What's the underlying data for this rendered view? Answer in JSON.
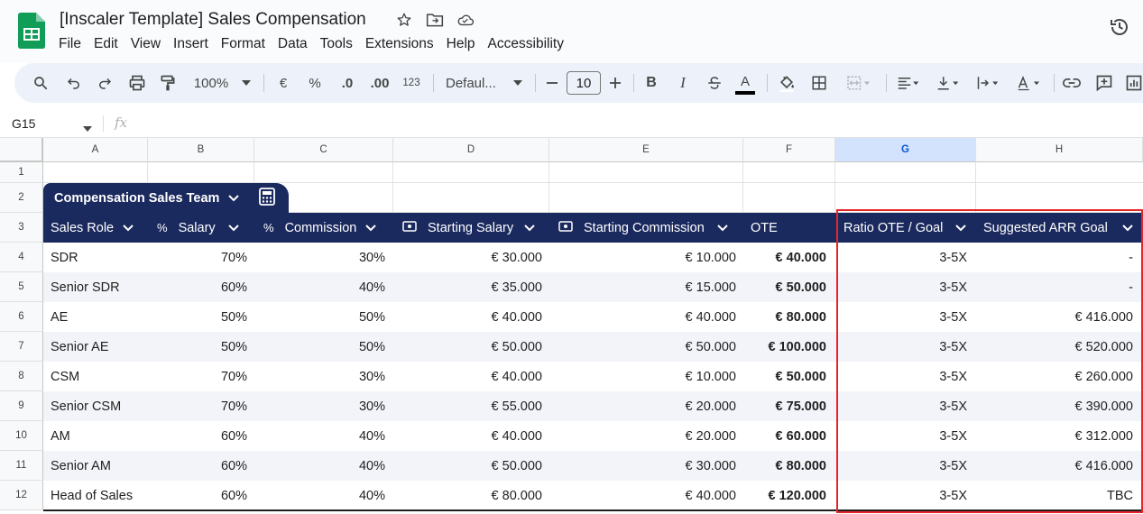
{
  "app": {
    "title": "[Inscaler Template] Sales Compensation",
    "menu": [
      "File",
      "Edit",
      "View",
      "Insert",
      "Format",
      "Data",
      "Tools",
      "Extensions",
      "Help",
      "Accessibility"
    ]
  },
  "toolbar": {
    "zoom": "100%",
    "currency": "€",
    "percent": "%",
    "dec_decrease": ".0",
    "dec_increase": ".00",
    "number_format": "123",
    "font": "Defaul...",
    "font_size": "10",
    "bold": "B",
    "italic": "I",
    "text_color": "A"
  },
  "formula_bar": {
    "name_box": "G15",
    "fx": "fx"
  },
  "columns": [
    "A",
    "B",
    "C",
    "D",
    "E",
    "F",
    "G",
    "H"
  ],
  "selected_column": "G",
  "rows": [
    "1",
    "2",
    "3",
    "4",
    "5",
    "6",
    "7",
    "8",
    "9",
    "10",
    "11",
    "12"
  ],
  "table": {
    "name": "Compensation Sales Team",
    "headers": [
      "Sales Role",
      "Salary",
      "Commission",
      "Starting Salary",
      "Starting Commission",
      "OTE",
      "Ratio OTE / Goal",
      "Suggested ARR Goal"
    ],
    "header_icons": [
      "",
      "%",
      "%",
      "₪",
      "₪",
      "",
      "",
      ""
    ],
    "records": [
      [
        "SDR",
        "70%",
        "30%",
        "€ 30.000",
        "€ 10.000",
        "€ 40.000",
        "3-5X",
        "-"
      ],
      [
        "Senior SDR",
        "60%",
        "40%",
        "€ 35.000",
        "€ 15.000",
        "€ 50.000",
        "3-5X",
        "-"
      ],
      [
        "AE",
        "50%",
        "50%",
        "€ 40.000",
        "€ 40.000",
        "€ 80.000",
        "3-5X",
        "€ 416.000"
      ],
      [
        "Senior AE",
        "50%",
        "50%",
        "€ 50.000",
        "€ 50.000",
        "€ 100.000",
        "3-5X",
        "€ 520.000"
      ],
      [
        "CSM",
        "70%",
        "30%",
        "€ 40.000",
        "€ 10.000",
        "€ 50.000",
        "3-5X",
        "€ 260.000"
      ],
      [
        "Senior CSM",
        "70%",
        "30%",
        "€ 55.000",
        "€ 20.000",
        "€ 75.000",
        "3-5X",
        "€ 390.000"
      ],
      [
        "AM",
        "60%",
        "40%",
        "€ 40.000",
        "€ 20.000",
        "€ 60.000",
        "3-5X",
        "€ 312.000"
      ],
      [
        "Senior AM",
        "60%",
        "40%",
        "€ 50.000",
        "€ 30.000",
        "€ 80.000",
        "3-5X",
        "€ 416.000"
      ],
      [
        "Head of Sales",
        "60%",
        "40%",
        "€ 80.000",
        "€ 40.000",
        "€ 120.000",
        "3-5X",
        "TBC"
      ]
    ]
  },
  "colors": {
    "table_header": "#1b2a5e",
    "highlight_border": "#e5252a",
    "sheets_green": "#0f9d58"
  }
}
